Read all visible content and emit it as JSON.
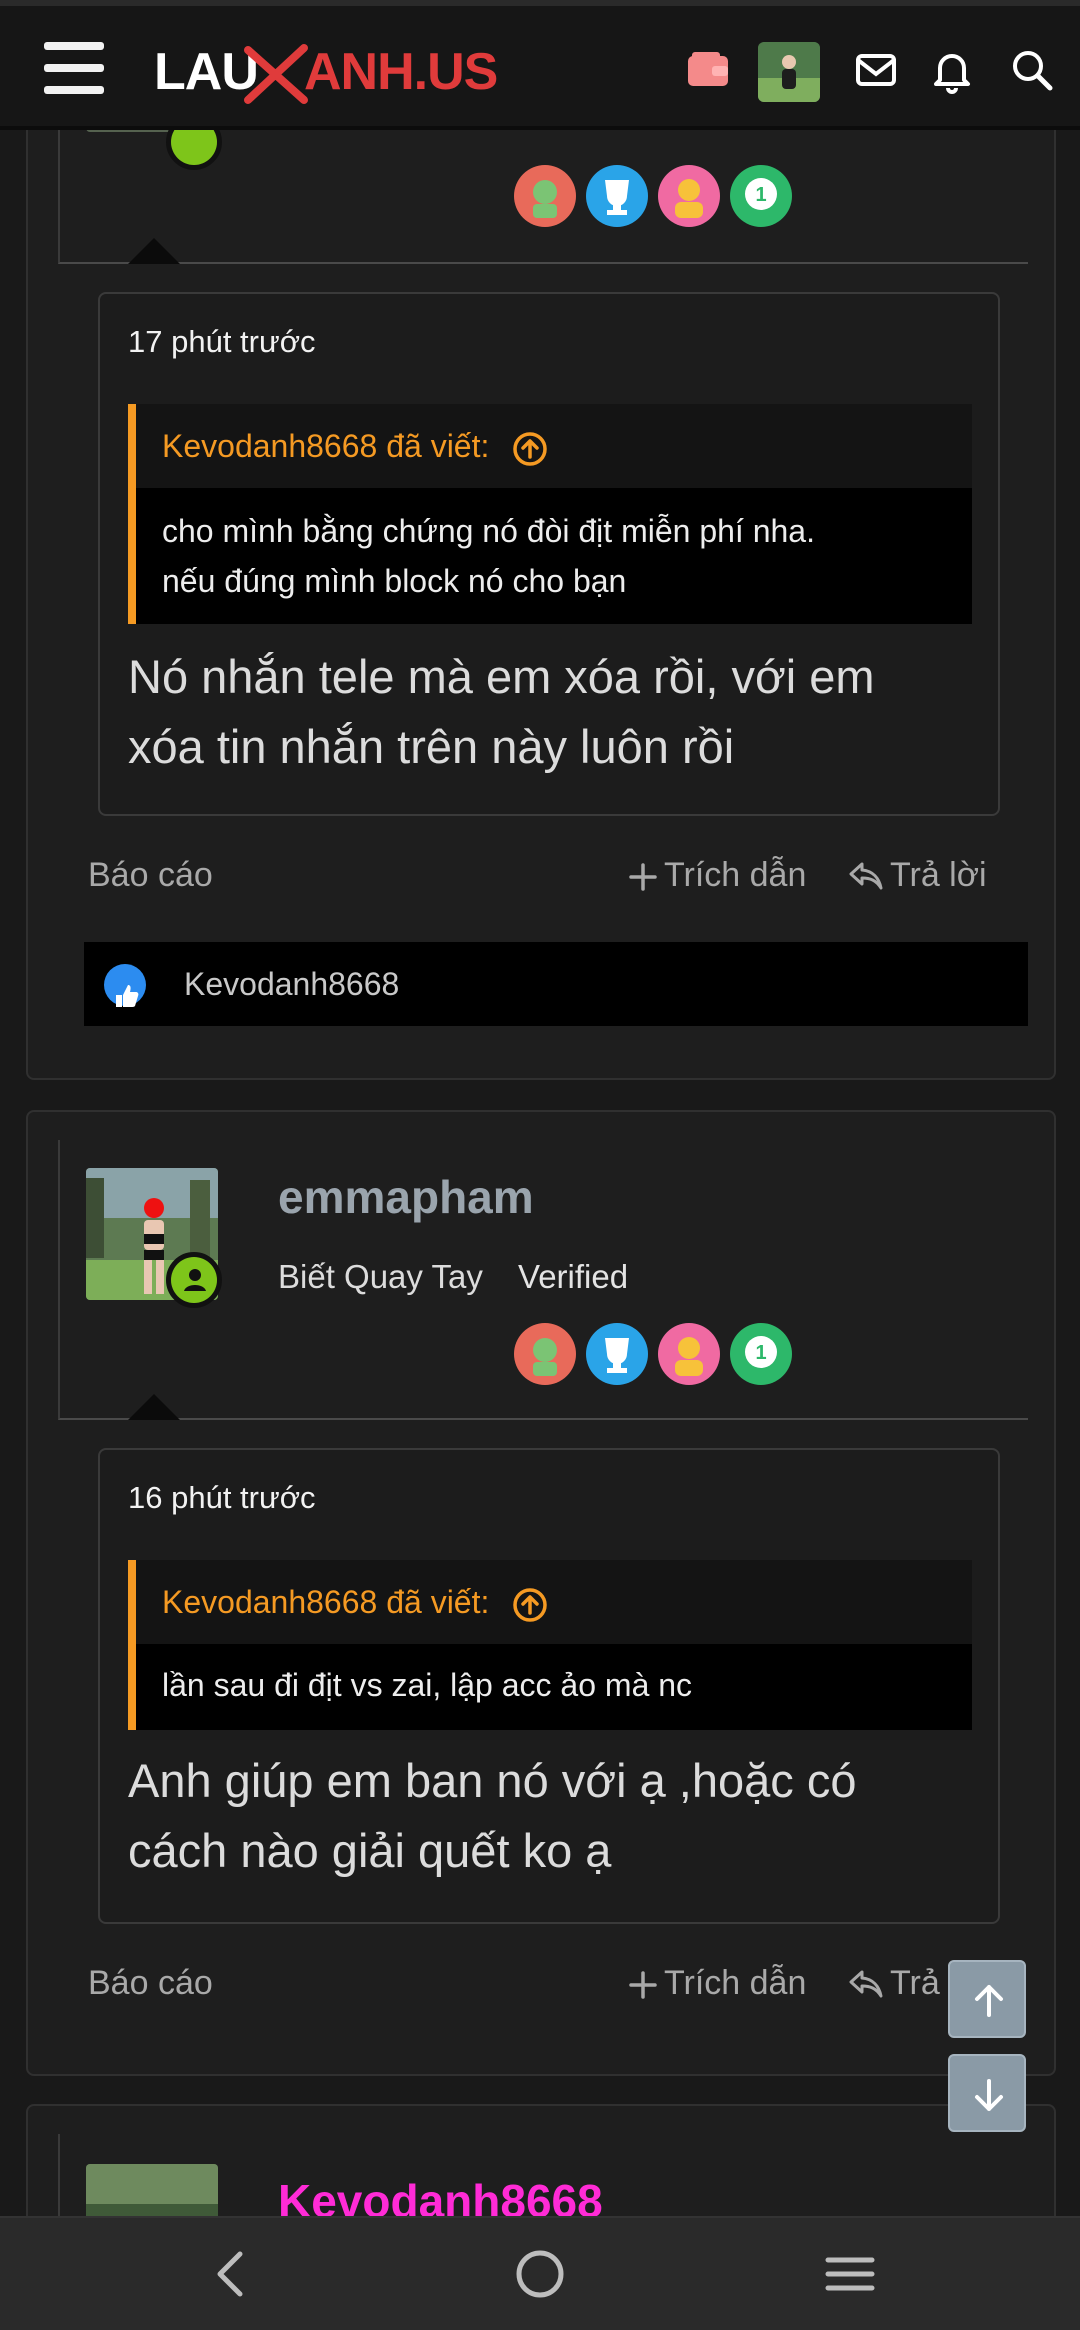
{
  "header": {
    "logo_left": "LAU",
    "logo_right": "ANH.US"
  },
  "posts": [
    {
      "time": "17 phút trước",
      "quote_author": "Kevodanh8668 đã viết:",
      "quote_lines": [
        "cho mình bằng chứng nó đòi địt miễn phí nha.",
        "nếu đúng mình block nó cho bạn"
      ],
      "text_lines": [
        "Nó nhắn tele mà em xóa rồi, với em",
        "xóa tin nhắn trên này luôn rồi"
      ],
      "report": "Báo cáo",
      "quote_btn": "Trích dẫn",
      "reply_btn": "Trả lời",
      "reaction_user": "Kevodanh8668"
    },
    {
      "username": "emmapham",
      "user_title": "Biết Quay Tay",
      "user_badge": "Verified",
      "time": "16 phút trước",
      "quote_author": "Kevodanh8668 đã viết:",
      "quote_lines": [
        "lần sau đi địt vs zai, lập acc ảo mà nc"
      ],
      "text_lines": [
        "Anh giúp em ban nó với ạ ,hoặc có",
        "cách nào giải quết ko ạ"
      ],
      "report": "Báo cáo",
      "quote_btn": "Trích dẫn",
      "reply_btn": "Trả lời"
    },
    {
      "username": "Kevodanh8668"
    }
  ],
  "colors": {
    "accent_orange": "#f59a23",
    "logo_red": "#e03b3b",
    "username_grey": "#9aa4ad",
    "username_magenta": "#ff2bd6",
    "online_green": "#7ec51a"
  }
}
